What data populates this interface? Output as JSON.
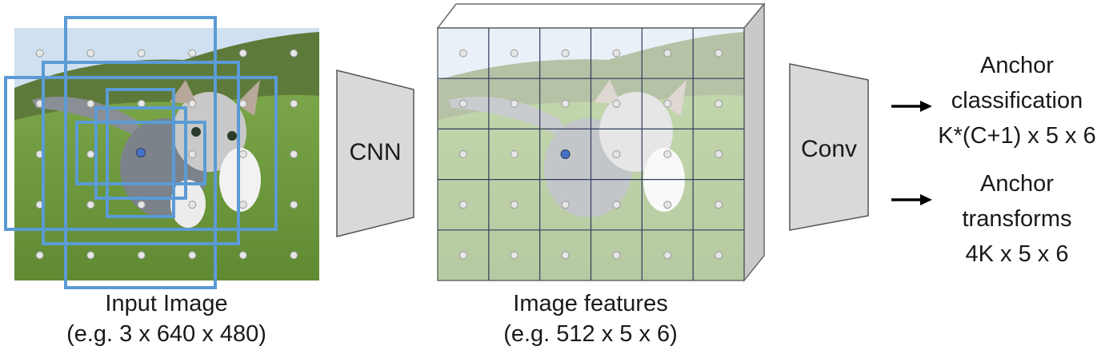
{
  "colors": {
    "anchor_box": "#5b9bd5",
    "anchor_point": "#4472c4",
    "grid_dot": "#d0d0d0",
    "grid_line": "#2f3d5c",
    "block_fill": "#d9d9d9",
    "block_stroke": "#555555",
    "sky": "#cfe0f0",
    "hills": "#5d7a3a",
    "grass": "#6e9a3e",
    "text": "#1a1a1a"
  },
  "input_image": {
    "caption_line1": "Input Image",
    "caption_line2": "(e.g. 3 x 640 x 480)"
  },
  "cnn": {
    "label": "CNN"
  },
  "features": {
    "caption_line1": "Image features",
    "caption_line2": "(e.g. 512 x 5 x 6)"
  },
  "conv": {
    "label": "Conv"
  },
  "outputs": {
    "classification": {
      "line1": "Anchor",
      "line2": "classification",
      "line3": "K*(C+1) x 5 x 6"
    },
    "transforms": {
      "line1": "Anchor",
      "line2": "transforms",
      "line3": "4K x 5 x 6"
    }
  },
  "grid": {
    "rows": 5,
    "cols": 6,
    "highlight_row": 2,
    "highlight_col": 2
  }
}
